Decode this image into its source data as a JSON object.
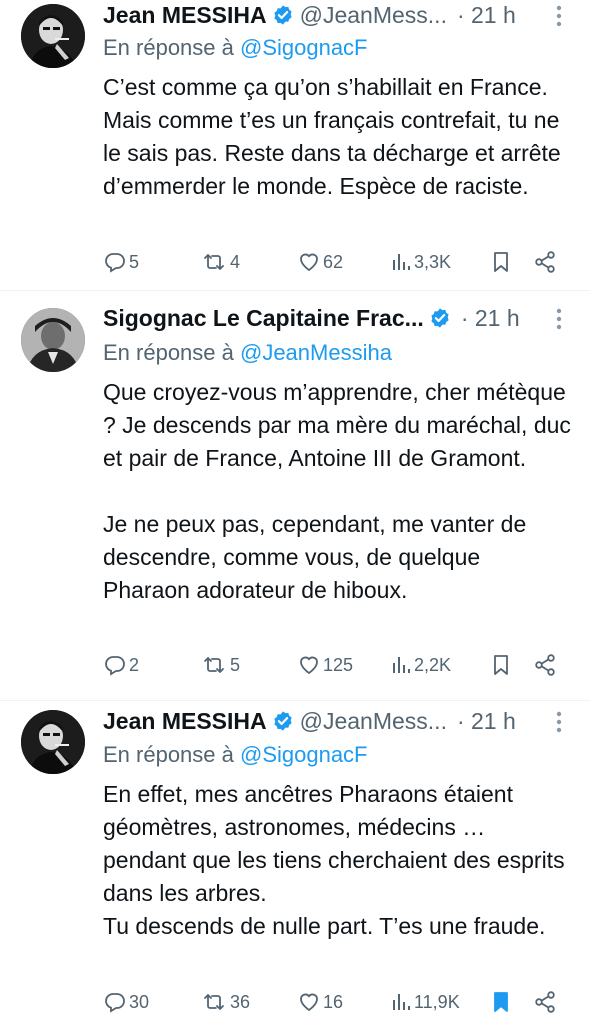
{
  "colors": {
    "text": "#0f1419",
    "secondary": "#536471",
    "accent": "#1d9bf0"
  },
  "tweets": [
    {
      "name": "Jean MESSIHA",
      "handle": "@JeanMess...",
      "time": "· 21 h",
      "reply_prefix": "En réponse à ",
      "reply_to": "@SigognacF",
      "text": "C’est comme ça qu’on s’habillait en France. Mais comme t’es un français contrefait, tu ne le sais pas. Reste dans ta décharge et arrête d’emmerder le monde. Espèce de raciste.",
      "replies": "5",
      "retweets": "4",
      "likes": "62",
      "views": "3,3K",
      "bookmarked": false
    },
    {
      "name": "Sigognac Le Capitaine Frac...",
      "handle": "",
      "time": "· 21 h",
      "reply_prefix": "En réponse à ",
      "reply_to": "@JeanMessiha",
      "text": "Que croyez-vous m’apprendre, cher métèque ? Je descends par ma mère du maréchal, duc et pair de France, Antoine III de Gramont.\n\nJe ne peux pas, cependant, me vanter de descendre, comme vous, de quelque Pharaon adorateur de hiboux.",
      "replies": "2",
      "retweets": "5",
      "likes": "125",
      "views": "2,2K",
      "bookmarked": false
    },
    {
      "name": "Jean MESSIHA",
      "handle": "@JeanMess...",
      "time": "· 21 h",
      "reply_prefix": "En réponse à ",
      "reply_to": "@SigognacF",
      "text": "En effet, mes ancêtres Pharaons étaient géomètres, astronomes, médecins … pendant que les tiens cherchaient des esprits dans les arbres.\nTu descends de nulle part. T’es une fraude.",
      "replies": "30",
      "retweets": "36",
      "likes": "16",
      "views": "11,9K",
      "bookmarked": true
    }
  ]
}
